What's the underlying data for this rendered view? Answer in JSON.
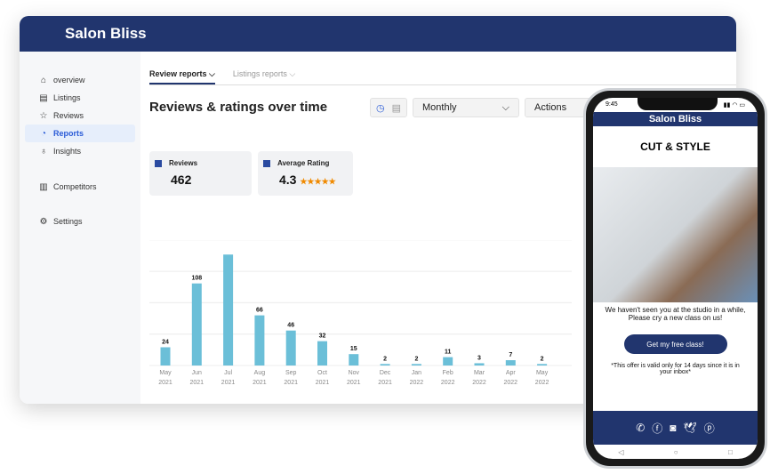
{
  "app": {
    "title": "Salon Bliss"
  },
  "sidebar": {
    "items": [
      {
        "label": "overview",
        "icon": "home-icon"
      },
      {
        "label": "Listings",
        "icon": "listings-icon"
      },
      {
        "label": "Reviews",
        "icon": "star-icon"
      },
      {
        "label": "Reports",
        "icon": "reports-icon",
        "active": true
      },
      {
        "label": "Insights",
        "icon": "bulb-icon"
      },
      {
        "label": "Competitors",
        "icon": "bar-chart-icon"
      },
      {
        "label": "Settings",
        "icon": "gear-icon"
      }
    ]
  },
  "tabs": [
    {
      "label": "Review reports"
    },
    {
      "label": "Listings reports"
    }
  ],
  "main": {
    "title": "Reviews & ratings over time",
    "period": "Monthly",
    "actions": "Actions"
  },
  "cards": {
    "reviews_label": "Reviews",
    "reviews_value": "462",
    "rating_label": "Average Rating",
    "rating_value": "4.3",
    "stars": "★★★★★",
    "rating_fraction": 0.86
  },
  "chart_data": {
    "type": "bar",
    "categories": [
      "May 2021",
      "Jun 2021",
      "Jul 2021",
      "Aug 2021",
      "Sep 2021",
      "Oct 2021",
      "Nov 2021",
      "Dec 2021",
      "Jan 2022",
      "Feb 2022",
      "Mar 2022",
      "Apr 2022",
      "May 2022"
    ],
    "values": [
      24,
      108,
      146,
      66,
      46,
      32,
      15,
      2,
      2,
      11,
      3,
      7,
      2
    ],
    "labels": [
      "24",
      "108",
      "",
      "66",
      "46",
      "32",
      "15",
      "2",
      "2",
      "11",
      "3",
      "7",
      "2"
    ],
    "ylim": [
      0,
      165
    ],
    "grid": true,
    "color": "#6bbfd8"
  },
  "phone": {
    "time": "9:45",
    "title": "Salon Bliss",
    "headline": "CUT & STYLE",
    "message": "We haven't seen you at the studio in a while, Please cry a new class on us!",
    "button": "Get my free class!",
    "note": "*This offer is valid only for 14 days since it is in your inbox*",
    "social": [
      "whatsapp-icon",
      "facebook-icon",
      "instagram-icon",
      "twitter-icon",
      "pinterest-icon"
    ]
  }
}
